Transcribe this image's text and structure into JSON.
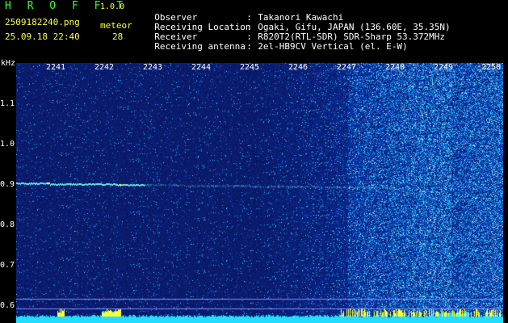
{
  "app": {
    "title": "H R O F F T",
    "version": "1.0.0"
  },
  "capture": {
    "filename": "2509182240.png",
    "datetime": "25.09.18 22:40",
    "meteor_label": "meteor",
    "meteor_count": "28"
  },
  "station": [
    {
      "key": "Observer",
      "value": "Takanori Kawachi"
    },
    {
      "key": "Receiving Location",
      "value": "Ogaki, Gifu, JAPAN (136.60E, 35.35N)"
    },
    {
      "key": "Receiver",
      "value": "R820T2(RTL-SDR) SDR-Sharp 53.372MHz"
    },
    {
      "key": "Receiving antenna",
      "value": "2el-HB9CV Vertical (el. E-W)"
    }
  ],
  "axis": {
    "unit": "kHz",
    "y_ticks": [
      "1.1",
      "1.0",
      "0.9",
      "0.8",
      "0.7",
      "0.6"
    ],
    "x_ticks": [
      "2241",
      "2242",
      "2243",
      "2244",
      "2245",
      "2246",
      "2247",
      "2248",
      "2249",
      "2250"
    ]
  },
  "colors": {
    "background": "#000000",
    "spectrum_base": "#1a1aa0",
    "signal": "#66ffff",
    "baseline": "#33ffff",
    "peak": "#ffff33"
  }
}
